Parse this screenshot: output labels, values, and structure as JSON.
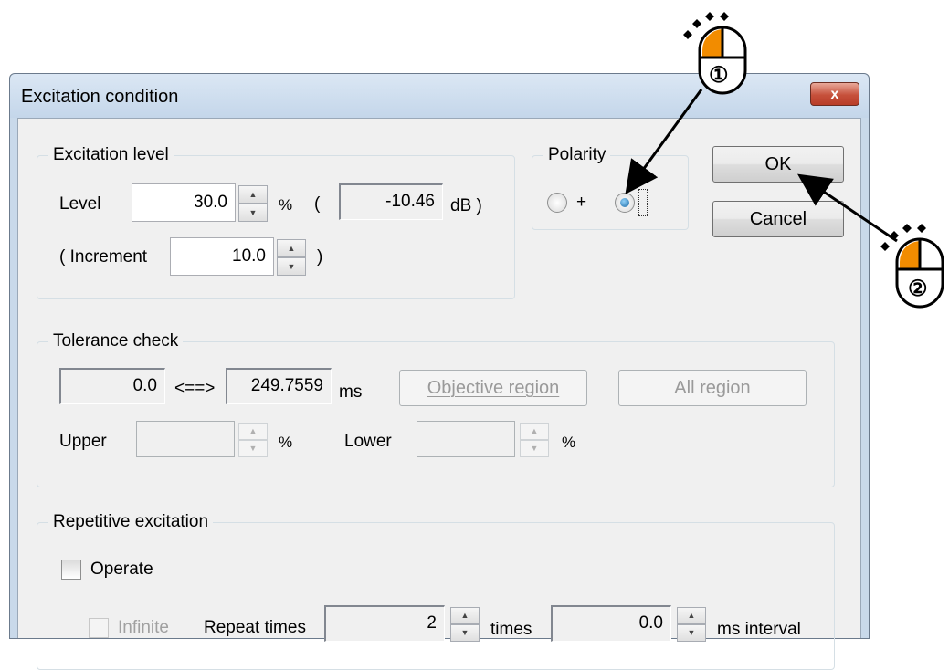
{
  "window": {
    "title": "Excitation condition",
    "close_label": "x"
  },
  "excitation_level": {
    "group_label": "Excitation level",
    "level_label": "Level",
    "level_value": "30.0",
    "percent_unit": "%",
    "open_paren": "(",
    "db_value": "-10.46",
    "db_unit": "dB )",
    "increment_label": "( Increment",
    "increment_value": "10.0",
    "close_paren": ")"
  },
  "polarity": {
    "group_label": "Polarity",
    "plus_label": "+",
    "selected": "minus"
  },
  "buttons": {
    "ok": "OK",
    "cancel": "Cancel"
  },
  "tolerance": {
    "group_label": "Tolerance check",
    "start_value": "0.0",
    "arrow": "<==>",
    "end_value": "249.7559",
    "ms_unit": "ms",
    "objective_button": "Objective region",
    "all_button": "All region",
    "upper_label": "Upper",
    "upper_unit": "%",
    "lower_label": "Lower",
    "lower_unit": "%"
  },
  "repetitive": {
    "group_label": "Repetitive excitation",
    "operate_label": "Operate",
    "infinite_label": "Infinite",
    "repeat_label": "Repeat times",
    "repeat_value": "2",
    "times_unit": "times",
    "interval_value": "0.0",
    "interval_unit": "ms interval"
  },
  "callouts": {
    "first": "①",
    "second": "②"
  },
  "colors": {
    "mouse_button": "#f28c00",
    "title_bar": "#c9d9ea",
    "close_button": "#c6503b"
  }
}
